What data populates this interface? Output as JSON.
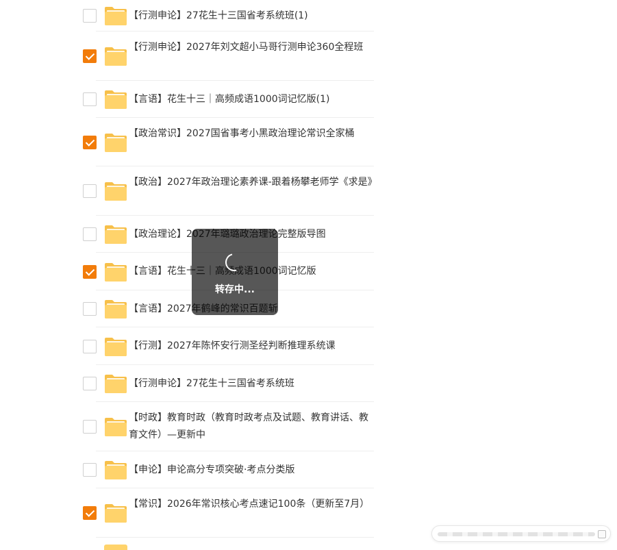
{
  "items": [
    {
      "title": "【行测申论】27花生十三国省考系统班(1)",
      "checked": false
    },
    {
      "title": "【行测申论】2027年刘文超小马哥行测申论360全程班",
      "checked": true
    },
    {
      "title": "【言语】花生十三｜高频成语1000词记忆版(1)",
      "checked": false
    },
    {
      "title": "【政治常识】2027国省事考小黑政治理论常识全家桶",
      "checked": true
    },
    {
      "title": "【政治】2027年政治理论素养课-跟着杨攀老师学《求是》",
      "checked": false
    },
    {
      "title": "【政治理论】2027年璐璐政治理论完整版导图",
      "checked": false
    },
    {
      "title": "【言语】花生十三｜高频成语1000词记忆版",
      "checked": true
    },
    {
      "title": "【言语】2027年鹤峰的常识百题斩",
      "checked": false
    },
    {
      "title": "【行测】2027年陈怀安行测圣经判断推理系统课",
      "checked": false
    },
    {
      "title": "【行测申论】27花生十三国省考系统班",
      "checked": false
    },
    {
      "title": "【时政】教育时政（教育时政考点及试题、教育讲话、教育文件）—更新中",
      "checked": false
    },
    {
      "title": "【申论】申论高分专项突破·考点分类版",
      "checked": false
    },
    {
      "title": "【常识】2026年常识核心考点速记100条（更新至7月）",
      "checked": true
    }
  ],
  "toast": {
    "text": "转存中..."
  },
  "icons": {
    "folder": "folder-icon",
    "spinner": "loading-spinner-icon",
    "check": "check-icon"
  },
  "colors": {
    "accent": "#f27c0a",
    "folder": "#ffd36b",
    "folder_back": "#f7c04a"
  }
}
